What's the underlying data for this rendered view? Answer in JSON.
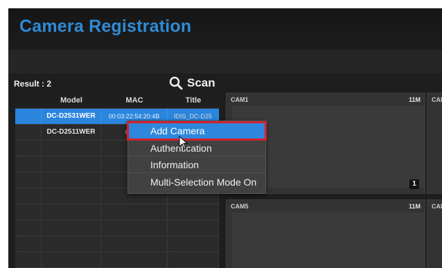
{
  "header": {
    "title": "Camera Registration"
  },
  "search": {
    "result_label": "Result : 2",
    "scan_label": "Scan"
  },
  "table": {
    "headers": [
      "Model",
      "MAC",
      "Title"
    ],
    "rows": [
      {
        "model": "DC-D2531WER",
        "mac": "00:03:22:54:20:4B",
        "title": "IDIS_DC-D25",
        "selected": true
      },
      {
        "model": "DC-D2511WER",
        "mac": "00:03:",
        "title": "",
        "selected": false
      }
    ]
  },
  "cameras": [
    {
      "name": "CAM1",
      "resolution": "11M",
      "number": "1"
    },
    {
      "name": "CAM",
      "resolution": ""
    },
    {
      "name": "CAM5",
      "resolution": "11M"
    },
    {
      "name": "CAM",
      "resolution": ""
    }
  ],
  "context_menu": {
    "items": [
      "Add Camera",
      "Authentication",
      "Information",
      "Multi-Selection Mode On"
    ],
    "active_index": 0
  },
  "colors": {
    "accent": "#2e87dd",
    "highlight_outline": "#d6202b",
    "title_blue": "#2f8bd8"
  }
}
